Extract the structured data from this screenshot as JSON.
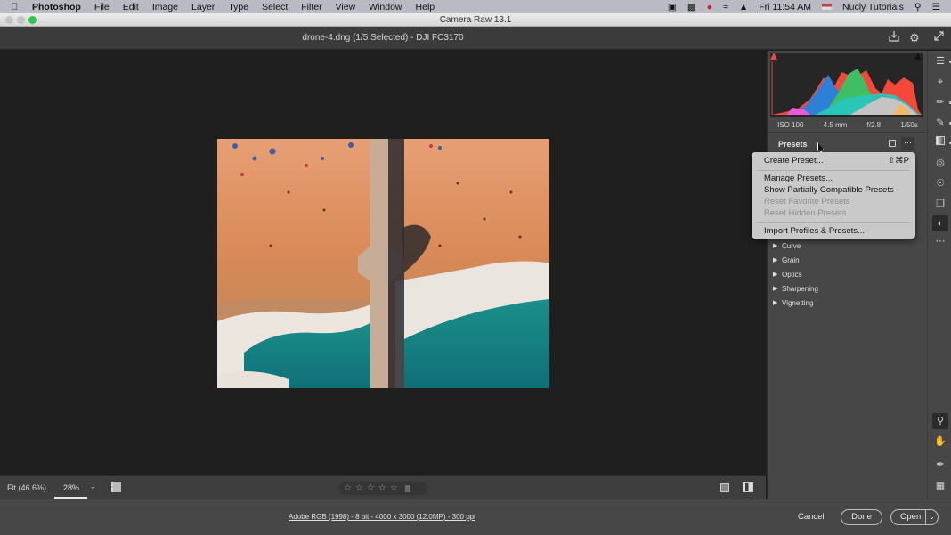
{
  "menubar": {
    "app_name": "Photoshop",
    "items": [
      "File",
      "Edit",
      "Image",
      "Layer",
      "Type",
      "Select",
      "Filter",
      "View",
      "Window",
      "Help"
    ],
    "clock": "Fri 11:54 AM",
    "user": "Nucly Tutorials"
  },
  "window": {
    "title": "Camera Raw 13.1"
  },
  "header": {
    "document_title": "drone-4.dng (1/5 Selected)  -  DJI FC3170"
  },
  "histogram": {
    "exif": {
      "iso": "ISO 100",
      "focal_length": "4.5 mm",
      "aperture": "f/2.8",
      "shutter": "1/50s"
    },
    "shadow_clipping_color": "#e84848",
    "highlight_clipping_color": "#111111"
  },
  "presets_panel": {
    "title": "Presets"
  },
  "context_menu": {
    "items": [
      {
        "label": "Create Preset...",
        "shortcut": "⇧⌘P",
        "enabled": true
      },
      {
        "label": "Manage Presets...",
        "enabled": true
      },
      {
        "label": "Show Partially Compatible Presets",
        "enabled": true
      },
      {
        "label": "Reset Favorite Presets",
        "enabled": false
      },
      {
        "label": "Reset Hidden Presets",
        "enabled": false
      },
      {
        "label": "Import Profiles & Presets...",
        "enabled": true
      }
    ]
  },
  "sections": [
    {
      "label": "Curve"
    },
    {
      "label": "Grain"
    },
    {
      "label": "Optics"
    },
    {
      "label": "Sharpening"
    },
    {
      "label": "Vignetting"
    }
  ],
  "bottom_bar": {
    "fit_label": "Fit (46.6%)",
    "zoom_value": "28%",
    "rating_stars": 0,
    "rating_max": 5
  },
  "footer": {
    "workflow_link": "Adobe RGB (1998) - 8 bit - 4000 x 3000 (12.0MP) - 300 ppi",
    "cancel_label": "Cancel",
    "done_label": "Done",
    "open_label": "Open"
  }
}
